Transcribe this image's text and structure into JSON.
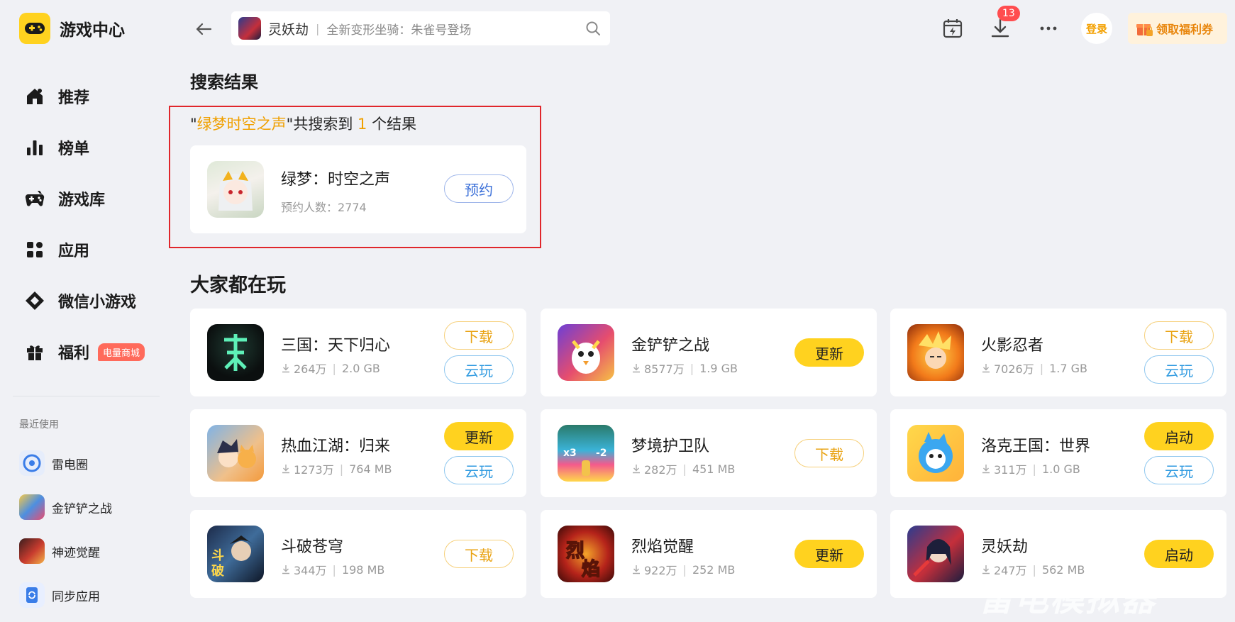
{
  "app": {
    "title": "游戏中心"
  },
  "sidebar": {
    "nav": [
      {
        "label": "推荐",
        "icon": "home-icon"
      },
      {
        "label": "榜单",
        "icon": "ranking-icon"
      },
      {
        "label": "游戏库",
        "icon": "gamepad-icon"
      },
      {
        "label": "应用",
        "icon": "apps-icon"
      },
      {
        "label": "微信小游戏",
        "icon": "wechat-game-icon"
      },
      {
        "label": "福利",
        "icon": "gift-icon",
        "badge": "电量商城"
      }
    ],
    "recent_title": "最近使用",
    "recent": [
      {
        "label": "雷电圈"
      },
      {
        "label": "金铲铲之战"
      },
      {
        "label": "神迹觉醒"
      },
      {
        "label": "同步应用"
      }
    ]
  },
  "header": {
    "search_game": "灵妖劫",
    "search_sep": "|",
    "search_hint": "全新变形坐骑：朱雀号登场",
    "download_count": "13",
    "login_label": "登录",
    "coupon_label": "领取福利券"
  },
  "search": {
    "section_title": "搜索结果",
    "quote_open": "\"",
    "keyword": "绿梦时空之声",
    "quote_close": "\"",
    "summary_mid": "共搜索到",
    "count": "1",
    "summary_end": "个结果",
    "result": {
      "name": "绿梦：时空之声",
      "meta": "预约人数：2774",
      "action": "预约"
    }
  },
  "popular": {
    "section_title": "大家都在玩",
    "games": [
      {
        "name": "三国：天下归心",
        "downloads": "264万",
        "size": "2.0 GB",
        "actions": [
          "下载",
          "云玩"
        ]
      },
      {
        "name": "金铲铲之战",
        "downloads": "8577万",
        "size": "1.9 GB",
        "actions": [
          "更新"
        ]
      },
      {
        "name": "火影忍者",
        "downloads": "7026万",
        "size": "1.7 GB",
        "actions": [
          "下载",
          "云玩"
        ]
      },
      {
        "name": "热血江湖：归来",
        "downloads": "1273万",
        "size": "764 MB",
        "actions": [
          "更新",
          "云玩"
        ]
      },
      {
        "name": "梦境护卫队",
        "downloads": "282万",
        "size": "451 MB",
        "actions": [
          "下载"
        ]
      },
      {
        "name": "洛克王国：世界",
        "downloads": "311万",
        "size": "1.0 GB",
        "actions": [
          "启动",
          "云玩"
        ]
      },
      {
        "name": "斗破苍穹",
        "downloads": "344万",
        "size": "198 MB",
        "actions": [
          "下载"
        ]
      },
      {
        "name": "烈焰觉醒",
        "downloads": "922万",
        "size": "252 MB",
        "actions": [
          "更新"
        ]
      },
      {
        "name": "灵妖劫",
        "downloads": "247万",
        "size": "562 MB",
        "actions": [
          "启动"
        ]
      }
    ]
  },
  "watermark": "雷电模拟器",
  "colors": {
    "accent": "#ffd21f",
    "highlight": "#f0a000",
    "result_border": "#e0262b",
    "cloud_blue": "#2f9ae0"
  }
}
